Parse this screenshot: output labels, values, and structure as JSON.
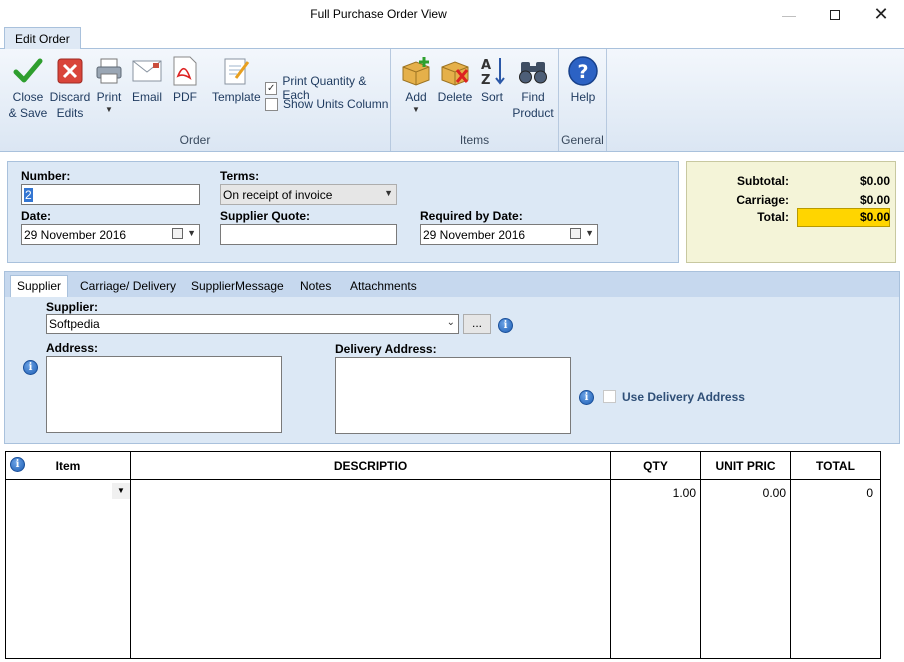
{
  "window": {
    "title": "Full Purchase Order View"
  },
  "ribbon": {
    "tab_label": "Edit Order",
    "order_group": {
      "label": "Order",
      "close_save": [
        "Close",
        "& Save"
      ],
      "discard": [
        "Discard",
        "Edits"
      ],
      "print": "Print",
      "email": "Email",
      "pdf": "PDF",
      "template": "Template",
      "print_qty_each": "Print Quantity & Each",
      "print_qty_each_checked": true,
      "show_units": "Show Units Column",
      "show_units_checked": false
    },
    "items_group": {
      "label": "Items",
      "add": "Add",
      "delete": "Delete",
      "sort": "Sort",
      "find_product": [
        "Find",
        "Product"
      ]
    },
    "general_group": {
      "label": "General",
      "help": "Help"
    }
  },
  "header_form": {
    "number_label": "Number:",
    "number_value": "2",
    "terms_label": "Terms:",
    "terms_value": "On receipt of invoice",
    "date_label": "Date:",
    "date_value": "29 November  2016",
    "supplier_quote_label": "Supplier Quote:",
    "supplier_quote_value": "",
    "required_by_label": "Required by Date:",
    "required_by_value": "29 November  2016"
  },
  "totals": {
    "subtotal_label": "Subtotal:",
    "subtotal_value": "$0.00",
    "carriage_label": "Carriage:",
    "carriage_value": "$0.00",
    "total_label": "Total:",
    "total_value": "$0.00",
    "total_highlight": "#ffd500"
  },
  "tabs": [
    "Supplier",
    "Carriage/ Delivery",
    "SupplierMessage",
    "Notes",
    "Attachments"
  ],
  "supplier_tab": {
    "supplier_label": "Supplier:",
    "supplier_value": "Softpedia",
    "ellipsis": "...",
    "address_label": "Address:",
    "delivery_address_label": "Delivery Address:",
    "use_delivery_label": "Use Delivery Address"
  },
  "grid": {
    "columns": [
      "Item",
      "DESCRIPTIO",
      "QTY",
      "UNIT PRIC",
      "TOTAL"
    ],
    "rows": [
      {
        "item": "",
        "description": "",
        "qty": "1.00",
        "unit_price": "0.00",
        "total": "0"
      }
    ]
  },
  "colors": {
    "accent": "#dce8f5",
    "ribbon_border": "#a9c1dc",
    "totals_bg": "#f4f4d8"
  }
}
